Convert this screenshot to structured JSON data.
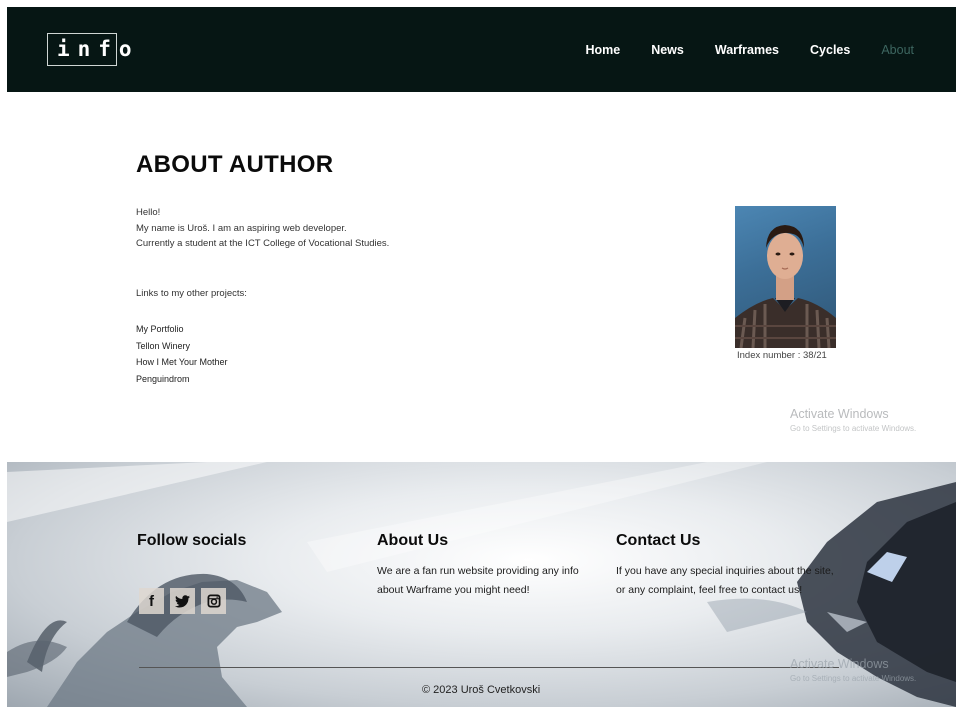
{
  "navbar": {
    "logo": "info",
    "items": [
      {
        "label": "Home",
        "active": false
      },
      {
        "label": "News",
        "active": false
      },
      {
        "label": "Warframes",
        "active": false
      },
      {
        "label": "Cycles",
        "active": false
      },
      {
        "label": "About",
        "active": true
      }
    ],
    "bg_color": "#061614",
    "active_color": "#3d6660"
  },
  "main": {
    "title": "ABOUT AUTHOR",
    "intro_lines": [
      "Hello!",
      "My name is Uroš. I am an aspiring web developer.",
      "Currently a student at the ICT College of Vocational Studies."
    ],
    "links_heading": "Links to my other projects:",
    "links": [
      "My Portfolio",
      "Tellon Winery",
      "How I Met Your Mother",
      "Penguindrom"
    ],
    "photo_caption": "Index number : 38/21"
  },
  "watermark": {
    "title": "Activate Windows",
    "subtitle": "Go to Settings to activate Windows."
  },
  "footer": {
    "socials_title": "Follow socials",
    "social_icons": [
      "facebook-icon",
      "twitter-icon",
      "instagram-icon"
    ],
    "about_title": "About Us",
    "about_text": "We are a fan run website providing any info about Warframe you might need!",
    "contact_title": "Contact Us",
    "contact_text": "If you have any special inquiries about the site, or any complaint, feel free to contact us!",
    "copyright": "© 2023 Uroš Cvetkovski"
  }
}
